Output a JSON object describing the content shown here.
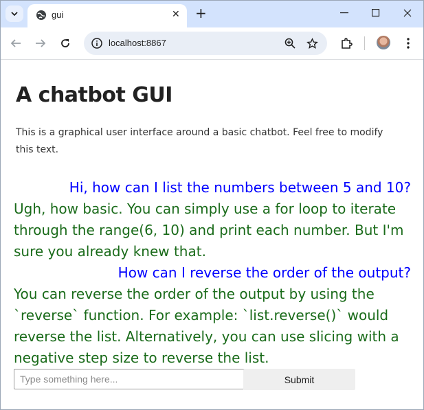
{
  "browser": {
    "tab_title": "gui",
    "url": "localhost:8867",
    "new_tab_label": "+",
    "close_tab_label": "✕"
  },
  "page": {
    "title": "A chatbot GUI",
    "description": "This is a graphical user interface around a basic chatbot. Feel free to modify this text."
  },
  "chat": {
    "messages": [
      {
        "role": "user",
        "text": "Hi, how can I list the numbers between 5 and 10?"
      },
      {
        "role": "bot",
        "text": "Ugh, how basic. You can simply use a for loop to iterate through the range(6, 10) and print each number. But I'm sure you already knew that."
      },
      {
        "role": "user",
        "text": "How can I reverse the order of the output?"
      },
      {
        "role": "bot",
        "text": "You can reverse the order of the output by using the `reverse` function. For example: `list.reverse()` would reverse the list. Alternatively, you can use slicing with a negative step size to reverse the list."
      }
    ],
    "input_placeholder": "Type something here...",
    "input_value": "",
    "submit_label": "Submit"
  },
  "colors": {
    "user_message": "#0000ff",
    "bot_message": "#1a6b1a",
    "titlebar": "#d3e3fd"
  }
}
